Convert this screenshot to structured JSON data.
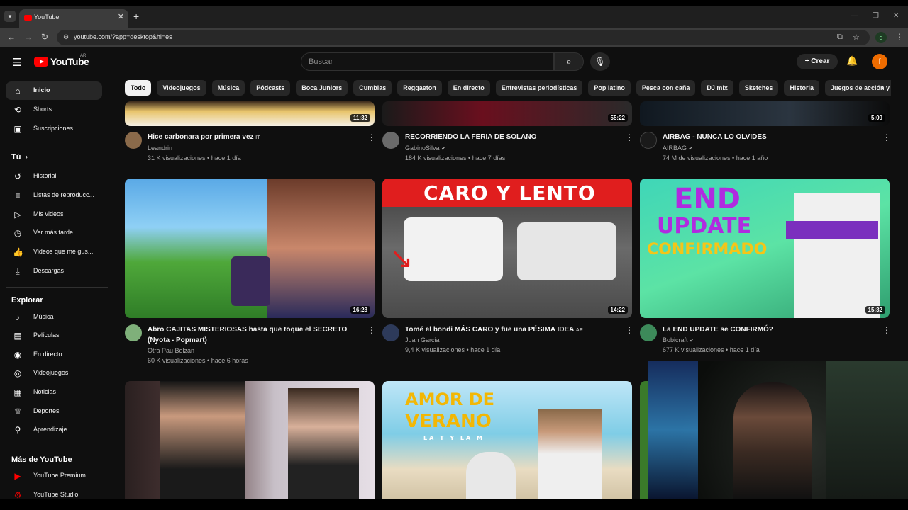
{
  "browser": {
    "tab_title": "YouTube",
    "url": "youtube.com/?app=desktop&hl=es",
    "profile_letter": "d"
  },
  "header": {
    "logo_text": "YouTube",
    "country_code": "AR",
    "search_placeholder": "Buscar",
    "create_label": "Crear",
    "avatar_letter": "f"
  },
  "chips": [
    "Todo",
    "Videojuegos",
    "Música",
    "Pódcasts",
    "Boca Juniors",
    "Cumbias",
    "Reggaeton",
    "En directo",
    "Entrevistas periodísticas",
    "Pop latino",
    "Pesca con caña",
    "DJ mix",
    "Sketches",
    "Historia",
    "Juegos de acción y av"
  ],
  "sidebar": {
    "main": [
      {
        "label": "Inicio",
        "icon": "home-icon"
      },
      {
        "label": "Shorts",
        "icon": "shorts-icon"
      },
      {
        "label": "Suscripciones",
        "icon": "subscriptions-icon"
      }
    ],
    "you_header": "Tú",
    "you": [
      {
        "label": "Historial",
        "icon": "history-icon"
      },
      {
        "label": "Listas de reproducc...",
        "icon": "playlist-icon"
      },
      {
        "label": "Mis videos",
        "icon": "my-videos-icon"
      },
      {
        "label": "Ver más tarde",
        "icon": "watch-later-icon"
      },
      {
        "label": "Videos que me gus...",
        "icon": "like-icon"
      },
      {
        "label": "Descargas",
        "icon": "download-icon"
      }
    ],
    "explore_header": "Explorar",
    "explore": [
      {
        "label": "Música",
        "icon": "music-icon"
      },
      {
        "label": "Películas",
        "icon": "movies-icon"
      },
      {
        "label": "En directo",
        "icon": "live-icon"
      },
      {
        "label": "Videojuegos",
        "icon": "gaming-icon"
      },
      {
        "label": "Noticias",
        "icon": "news-icon"
      },
      {
        "label": "Deportes",
        "icon": "trophy-icon"
      },
      {
        "label": "Aprendizaje",
        "icon": "learning-icon"
      }
    ],
    "more_header": "Más de YouTube",
    "more": [
      {
        "label": "YouTube Premium",
        "icon": "youtube-premium-icon"
      },
      {
        "label": "YouTube Studio",
        "icon": "youtube-studio-icon"
      }
    ]
  },
  "videos": [
    {
      "title": "Hice carbonara por primera vez",
      "title_suffix": "IT",
      "channel": "Leandrin",
      "verified": false,
      "meta": "31 K visualizaciones • hace 1 día",
      "duration": "11:32"
    },
    {
      "title": "RECORRIENDO LA FERIA DE SOLANO",
      "title_suffix": "",
      "channel": "GabinoSilva",
      "verified": true,
      "meta": "184 K visualizaciones • hace 7 días",
      "duration": "55:22"
    },
    {
      "title": "AIRBAG - NUNCA LO OLVIDES",
      "title_suffix": "",
      "channel": "AIRBAG",
      "verified": true,
      "meta": "74 M de visualizaciones • hace 1 año",
      "duration": "5:09"
    },
    {
      "title": "Abro CAJITAS MISTERIOSAS hasta que toque el SECRETO (Nyota - Popmart)",
      "title_suffix": "",
      "channel": "Otra Pau Bolzan",
      "verified": false,
      "meta": "60 K visualizaciones • hace 6 horas",
      "duration": "16:28"
    },
    {
      "title": "Tomé el bondi MÁS CARO y fue una PÉSIMA IDEA",
      "title_suffix": "AR",
      "channel": "Juan Garcia",
      "verified": false,
      "meta": "9,4 K visualizaciones • hace 1 día",
      "duration": "14:22",
      "thumb_text": "CARO Y LENTO"
    },
    {
      "title": "La END UPDATE se CONFIRMÓ?",
      "title_suffix": "",
      "channel": "Bobicraft",
      "verified": true,
      "meta": "677 K visualizaciones • hace 1 día",
      "duration": "15:32",
      "thumb_text_1": "END",
      "thumb_text_2": "UPDATE",
      "thumb_text_3": "CONFIRMADO"
    },
    {
      "thumb_text_1": "AMOR DE",
      "thumb_text_2": "VERANO",
      "thumb_text_3": "LA T Y LA M"
    }
  ]
}
